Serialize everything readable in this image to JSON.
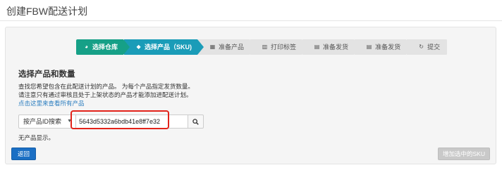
{
  "page": {
    "title": "创建FBW配送计划"
  },
  "steps": [
    {
      "label": "选择仓库",
      "icon": "globe-icon",
      "state": "done"
    },
    {
      "label": "选择产品（SKU)",
      "icon": "tag-icon",
      "state": "active"
    },
    {
      "label": "准备产品",
      "icon": "grid-icon",
      "state": "todo"
    },
    {
      "label": "打印标签",
      "icon": "barcode-icon",
      "state": "todo"
    },
    {
      "label": "准备发货",
      "icon": "list-icon",
      "state": "todo"
    },
    {
      "label": "准备发货",
      "icon": "list-icon",
      "state": "todo"
    },
    {
      "label": "提交",
      "icon": "refresh-icon",
      "state": "todo"
    }
  ],
  "section": {
    "title": "选择产品和数量",
    "desc_line1": "查找您希望包含在此配送计划的产品。 为每个产品指定发货数量。",
    "desc_line2": "请注意只有通过审核且处于上架状态的产品才能添加进配送计划。",
    "view_all_link": "点击这里来查看所有产品"
  },
  "search": {
    "mode": "按产品ID搜索",
    "value": "5643d5332a6bdb41e8ff7e32"
  },
  "results": {
    "empty_text": "无产品显示。"
  },
  "actions": {
    "back_label": "返回",
    "add_selected_label": "增加选中的SKU"
  },
  "colors": {
    "step_done": "#16a087",
    "step_active": "#1a9cb8",
    "primary": "#1b6fc4",
    "highlight": "#e2231a"
  }
}
